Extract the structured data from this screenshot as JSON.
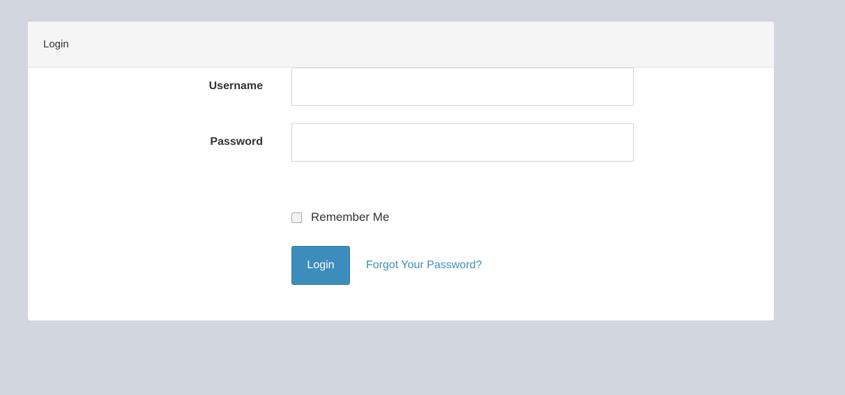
{
  "card": {
    "title": "Login"
  },
  "form": {
    "username_label": "Username",
    "username_value": "",
    "password_label": "Password",
    "password_value": "",
    "remember_label": "Remember Me",
    "remember_checked": false,
    "login_button": "Login",
    "forgot_link": "Forgot Your Password?"
  },
  "colors": {
    "background": "#d2d6de",
    "primary": "#3c8dbc",
    "header_bg": "#f5f5f5"
  }
}
